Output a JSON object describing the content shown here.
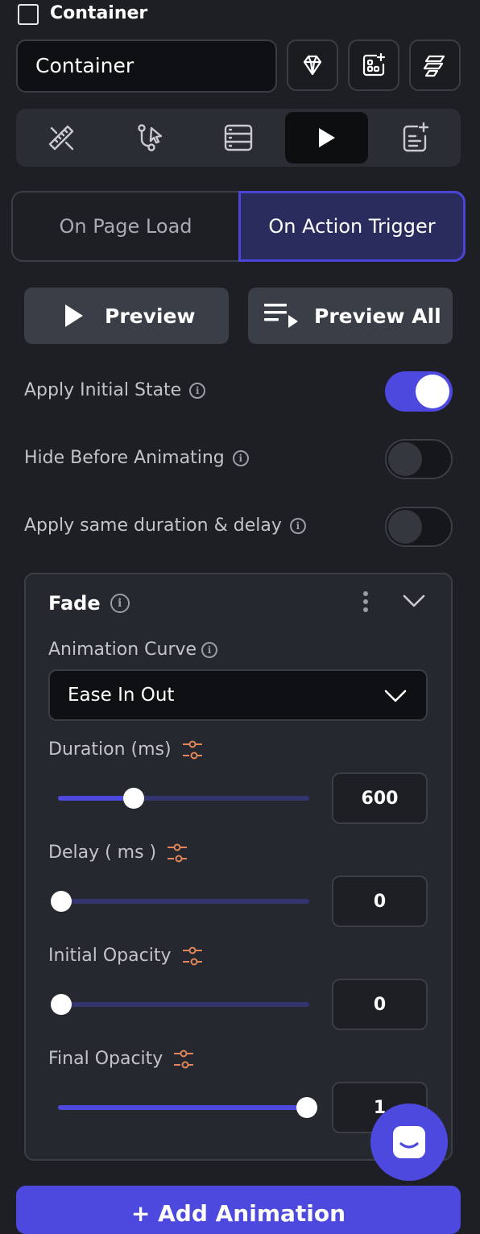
{
  "header": {
    "title": "Container",
    "name_value": "Container"
  },
  "icons": {
    "gem": "diamond-icon",
    "add_widget": "add-widget-icon",
    "theme": "stack-icon",
    "tabs": [
      "ruler-pencil-icon",
      "workflow-icon",
      "database-icon",
      "play-icon",
      "add-note-icon"
    ]
  },
  "trigger": {
    "options": [
      "On Page Load",
      "On Action Trigger"
    ],
    "selected": "On Action Trigger"
  },
  "preview": {
    "preview_label": "Preview",
    "preview_all_label": "Preview All"
  },
  "settings": {
    "apply_initial_state": {
      "label": "Apply Initial State",
      "on": true
    },
    "hide_before_animating": {
      "label": "Hide Before Animating",
      "on": false
    },
    "apply_same_duration": {
      "label": "Apply same duration & delay",
      "on": false
    }
  },
  "animation": {
    "title": "Fade",
    "curve_label": "Animation Curve",
    "curve_value": "Ease In Out",
    "fields": [
      {
        "label": "Duration (ms)",
        "value": "600",
        "fraction": 0.3
      },
      {
        "label": "Delay ( ms )",
        "value": "0",
        "fraction": 0
      },
      {
        "label": "Initial Opacity",
        "value": "0",
        "fraction": 0
      },
      {
        "label": "Final Opacity",
        "value": "1",
        "fraction": 1
      }
    ]
  },
  "footer": {
    "add_label": "+ Add Animation"
  },
  "colors": {
    "accent": "#4d48de",
    "background": "#1d1f24",
    "variable_icon": "#e0865a"
  }
}
